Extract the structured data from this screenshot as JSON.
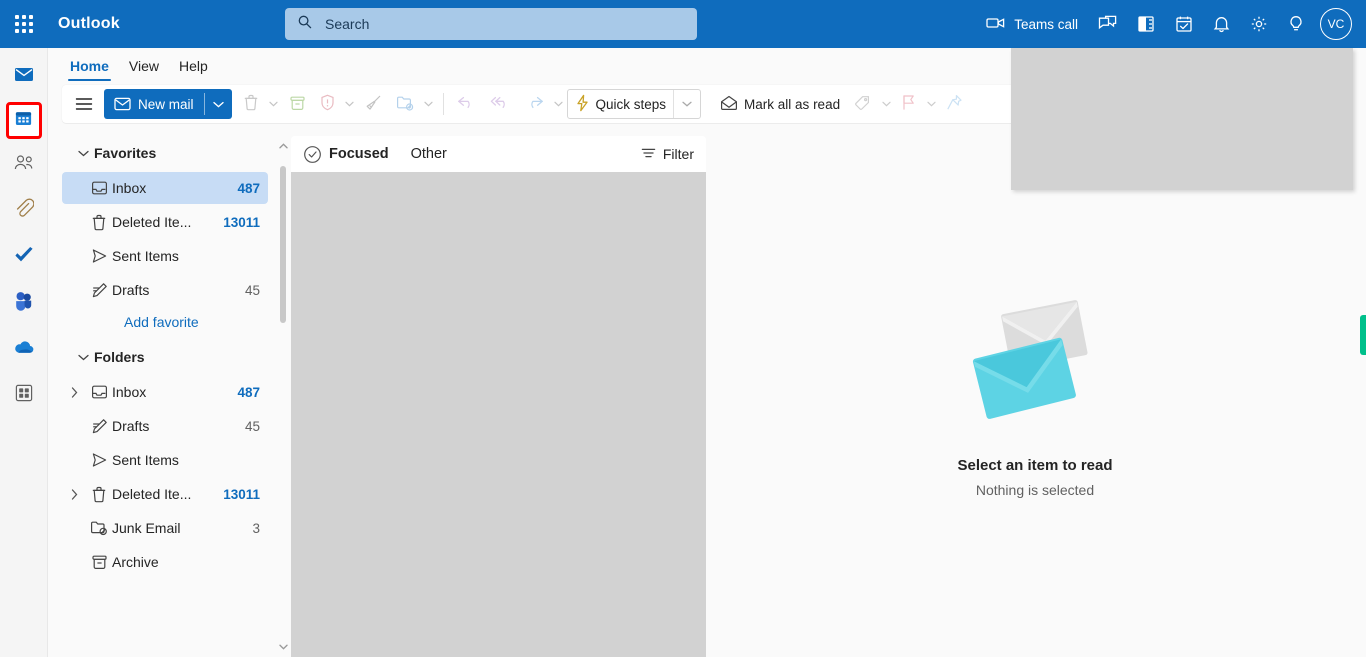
{
  "topbar": {
    "app_name": "Outlook",
    "waffle_icon": "app-launcher-grid-icon",
    "search": {
      "placeholder": "Search",
      "icon": "search-icon"
    },
    "teams_call_label": "Teams call",
    "icons": [
      {
        "name": "video-camera-icon"
      },
      {
        "name": "chat-icon"
      },
      {
        "name": "office-app-icon"
      },
      {
        "name": "calendar-check-icon"
      },
      {
        "name": "bell-notifications-icon"
      },
      {
        "name": "gear-settings-icon"
      },
      {
        "name": "lightbulb-tips-icon"
      }
    ],
    "avatar_initials": "VC",
    "accent_color": "#0f6cbd"
  },
  "rail": {
    "items": [
      {
        "name": "mail",
        "icon": "mail-icon",
        "selected": true
      },
      {
        "name": "calendar",
        "icon": "calendar-icon",
        "highlighted": true
      },
      {
        "name": "people",
        "icon": "people-icon"
      },
      {
        "name": "files",
        "icon": "paperclip-attachment-icon"
      },
      {
        "name": "to-do",
        "icon": "checkmark-todo-icon"
      },
      {
        "name": "teams",
        "icon": "teams-icon"
      },
      {
        "name": "onedrive",
        "icon": "cloud-onedrive-icon"
      },
      {
        "name": "more-apps",
        "icon": "apps-grid-icon"
      }
    ],
    "highlight_color": "#ff0000"
  },
  "tabs": [
    {
      "label": "Home",
      "active": true
    },
    {
      "label": "View",
      "active": false
    },
    {
      "label": "Help",
      "active": false
    }
  ],
  "ribbon": {
    "hamburger_icon": "hamburger-menu-icon",
    "new_mail": {
      "label": "New mail",
      "icon": "envelope-icon",
      "chevron": "chevron-down-icon"
    },
    "delete": {
      "icon": "trash-delete-icon"
    },
    "archive": {
      "icon": "archive-icon"
    },
    "report": {
      "icon": "shield-report-icon"
    },
    "sweep": {
      "icon": "broom-sweep-icon"
    },
    "move_to": {
      "icon": "folder-move-icon"
    },
    "undo": {
      "icon": "undo-arrow-icon"
    },
    "reply_all": {
      "icon": "reply-all-arrow-icon"
    },
    "forward": {
      "icon": "forward-arrow-icon"
    },
    "quick_steps": {
      "label": "Quick steps",
      "icon": "lightning-bolt-icon",
      "chevron": "chevron-down-icon",
      "icon_color": "#c9a227"
    },
    "mark_all_read": {
      "label": "Mark all as read",
      "icon": "open-envelope-icon"
    },
    "tag": {
      "icon": "tag-icon"
    },
    "flag": {
      "icon": "flag-icon"
    },
    "pin": {
      "icon": "pin-icon"
    }
  },
  "folder_pane": {
    "favorites": {
      "title": "Favorites",
      "chevron": "chevron-down-icon",
      "items": [
        {
          "label": "Inbox",
          "count": "487",
          "icon": "inbox-icon",
          "selected": true,
          "count_style": "blue"
        },
        {
          "label": "Deleted Ite...",
          "count": "13011",
          "icon": "trash-delete-icon",
          "count_style": "blue"
        },
        {
          "label": "Sent Items",
          "count": "",
          "icon": "send-icon"
        },
        {
          "label": "Drafts",
          "count": "45",
          "icon": "draft-pencil-icon",
          "count_style": "gray"
        }
      ],
      "add_favorite_label": "Add favorite"
    },
    "folders": {
      "title": "Folders",
      "chevron": "chevron-down-icon",
      "items": [
        {
          "label": "Inbox",
          "count": "487",
          "icon": "inbox-icon",
          "expandable": true,
          "count_style": "blue"
        },
        {
          "label": "Drafts",
          "count": "45",
          "icon": "draft-pencil-icon",
          "expandable": false,
          "count_style": "gray"
        },
        {
          "label": "Sent Items",
          "count": "",
          "icon": "send-icon",
          "expandable": false
        },
        {
          "label": "Deleted Ite...",
          "count": "13011",
          "icon": "trash-delete-icon",
          "expandable": true,
          "count_style": "blue"
        },
        {
          "label": "Junk Email",
          "count": "3",
          "icon": "junk-folder-icon",
          "expandable": false,
          "count_style": "gray"
        },
        {
          "label": "Archive",
          "count": "",
          "icon": "archive-icon",
          "expandable": false
        }
      ]
    },
    "scrollbar": {
      "up_icon": "chevron-up-icon",
      "down_icon": "chevron-down-icon"
    }
  },
  "message_list": {
    "select_all_icon": "circle-check-select-icon",
    "pivots": [
      {
        "label": "Focused",
        "active": true
      },
      {
        "label": "Other",
        "active": false
      }
    ],
    "filter": {
      "label": "Filter",
      "icon": "filter-lines-icon"
    }
  },
  "reading_pane": {
    "illustration": "two-envelopes-empty-state-icon",
    "title": "Select an item to read",
    "subtitle": "Nothing is selected",
    "envelope_color": "#4ecfe0",
    "envelope_back_color": "#dcdcdc"
  },
  "overlay_panel": {
    "name": "loading-placeholder-panel",
    "color": "#d2d2d2"
  },
  "edge_tab": {
    "name": "feedback-edge-tab",
    "color": "#00c08b"
  }
}
